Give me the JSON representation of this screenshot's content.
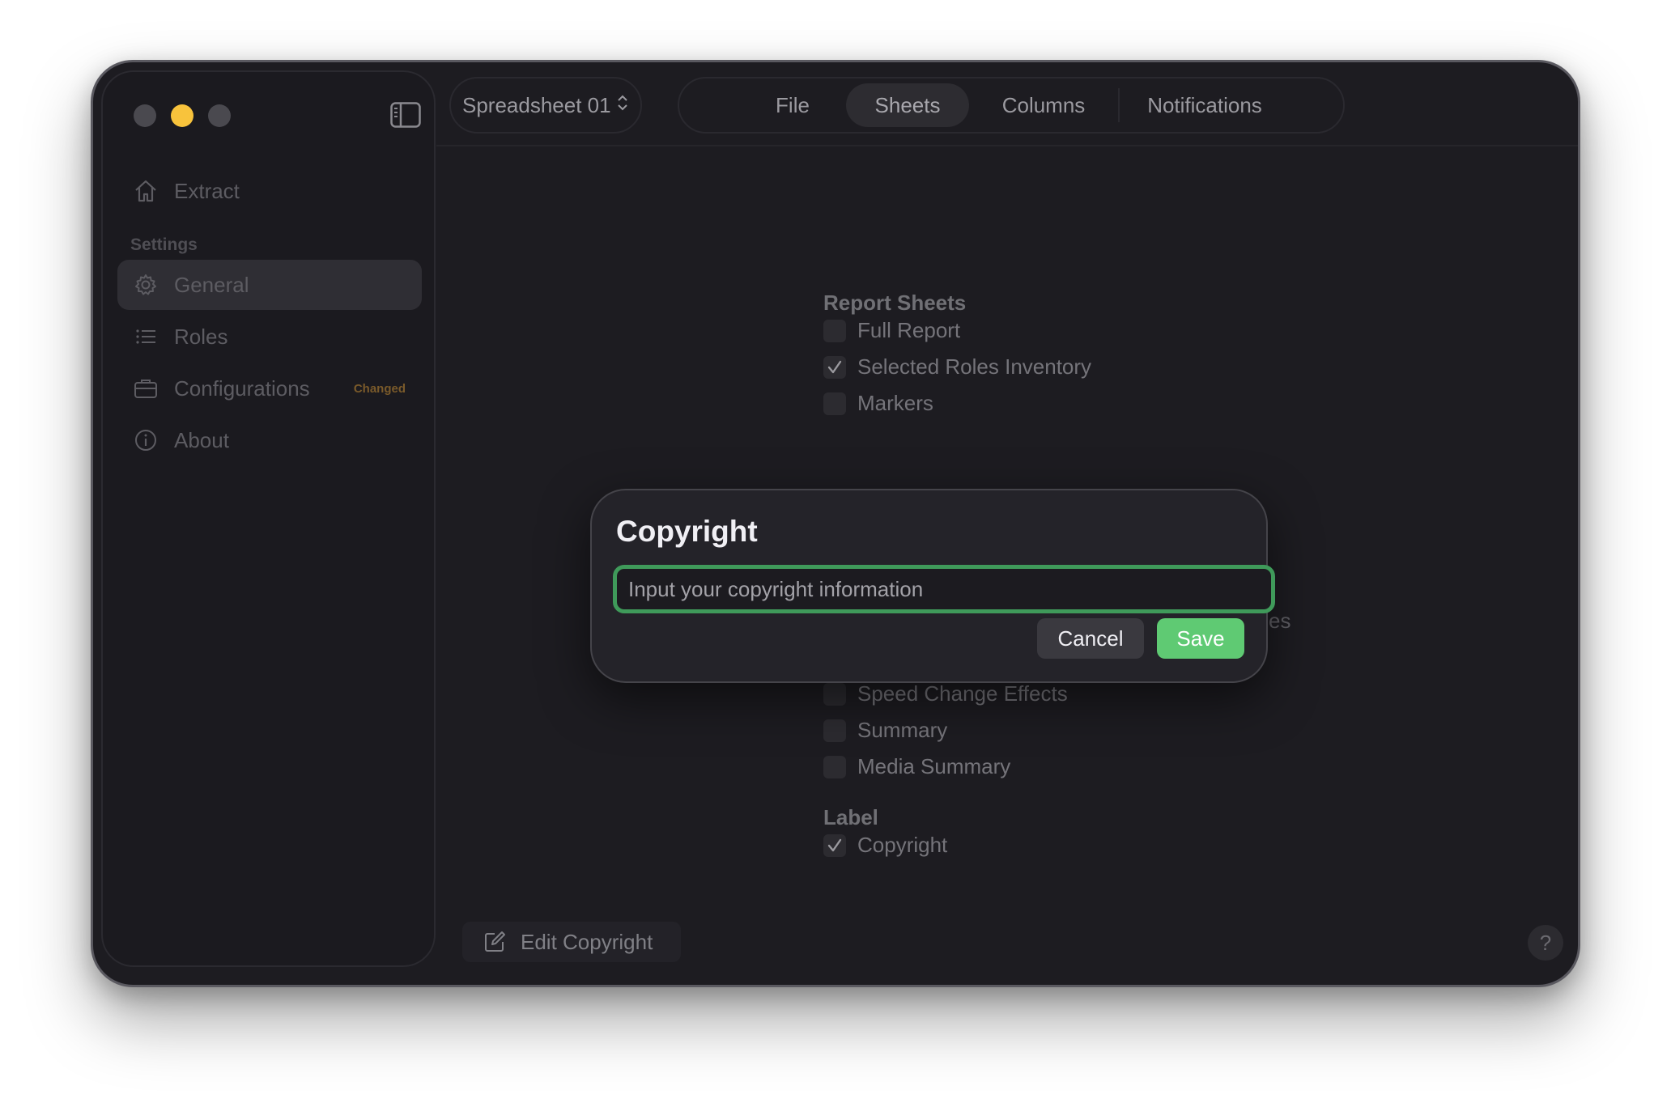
{
  "sidebar": {
    "items": [
      {
        "label": "Extract",
        "icon": "house-icon"
      },
      {
        "label": "General",
        "icon": "gear-icon"
      },
      {
        "label": "Roles",
        "icon": "list-icon"
      },
      {
        "label": "Configurations",
        "icon": "briefcase-icon",
        "badge": "Changed"
      },
      {
        "label": "About",
        "icon": "info-icon"
      }
    ],
    "section_heading": "Settings"
  },
  "toolbar": {
    "document": "Spreadsheet 01",
    "tabs": [
      "File",
      "Sheets",
      "Columns",
      "Notifications"
    ],
    "active_tab": "Sheets"
  },
  "content": {
    "report_sheets_title": "Report Sheets",
    "report_sheets": [
      {
        "label": "Full Report",
        "checked": false
      },
      {
        "label": "Selected Roles Inventory",
        "checked": true
      },
      {
        "label": "Markers",
        "checked": false
      },
      {
        "label": "Speed Change Effects",
        "checked": false
      },
      {
        "label": "Summary",
        "checked": false
      },
      {
        "label": "Media Summary",
        "checked": false
      }
    ],
    "obscured_fragment": "es",
    "label_title": "Label",
    "label_items": [
      {
        "label": "Copyright",
        "checked": true
      }
    ]
  },
  "footer": {
    "edit_copyright": "Edit Copyright",
    "help": "?"
  },
  "dialog": {
    "title": "Copyright",
    "input_placeholder": "Input your copyright information",
    "input_value": "",
    "cancel": "Cancel",
    "save": "Save"
  },
  "colors": {
    "accent": "#5fca73",
    "focus_ring": "#3f9a5a",
    "badge": "#7a5a2a"
  }
}
